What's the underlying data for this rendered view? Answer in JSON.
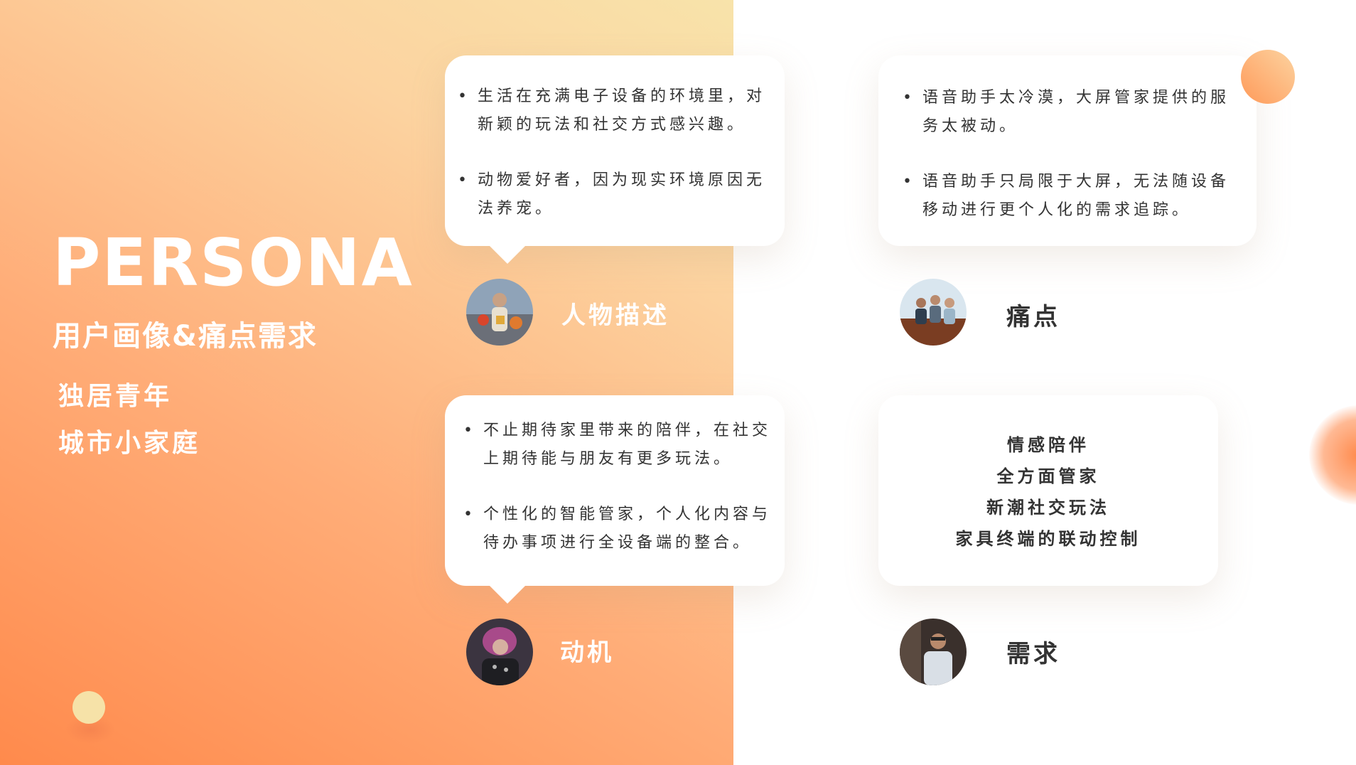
{
  "header": {
    "title": "PERSONA",
    "subtitle": "用户画像&痛点需求"
  },
  "persona_tags": [
    "独居青年",
    "城市小家庭"
  ],
  "sections": {
    "persona": {
      "label": "人物描述",
      "items": [
        "生活在充满电子设备的环境里，对新颖的玩法和社交方式感兴趣。",
        "动物爱好者，因为现实环境原因无法养宠。"
      ]
    },
    "pain": {
      "label": "痛点",
      "items": [
        "语音助手太冷漠，大屏管家提供的服务太被动。",
        "语音助手只局限于大屏，无法随设备移动进行更个人化的需求追踪。"
      ]
    },
    "motive": {
      "label": "动机",
      "items": [
        "不止期待家里带来的陪伴，在社交上期待能与朋友有更多玩法。",
        "个性化的智能管家，个人化内容与待办事项进行全设备端的整合。"
      ]
    },
    "need": {
      "label": "需求",
      "items": [
        "情感陪伴",
        "全方面管家",
        "新潮社交玩法",
        "家具终端的联动控制"
      ]
    }
  },
  "colors": {
    "accent_orange": "#ff8a4c",
    "accent_yellow": "#f8e3aa",
    "text_dark": "#333333"
  }
}
